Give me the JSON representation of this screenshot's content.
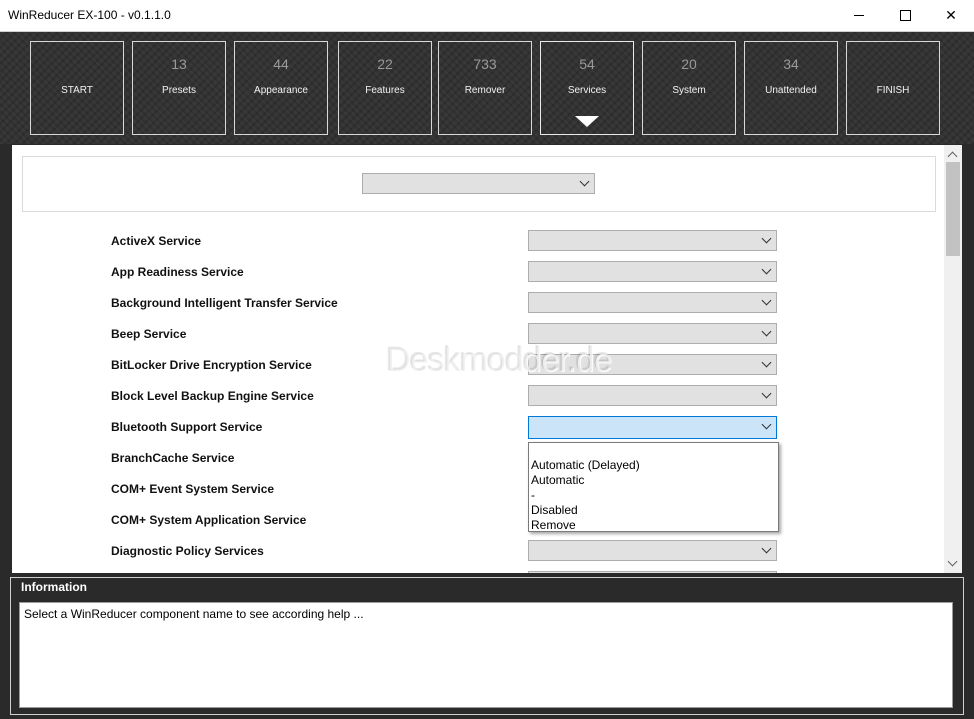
{
  "window": {
    "title": "WinReducer EX-100 - v0.1.1.0"
  },
  "steps": [
    {
      "count": "",
      "label": "START"
    },
    {
      "count": "13",
      "label": "Presets"
    },
    {
      "count": "44",
      "label": "Appearance"
    },
    {
      "count": "22",
      "label": "Features"
    },
    {
      "count": "733",
      "label": "Remover"
    },
    {
      "count": "54",
      "label": "Services"
    },
    {
      "count": "20",
      "label": "System"
    },
    {
      "count": "34",
      "label": "Unattended"
    },
    {
      "count": "",
      "label": "FINISH"
    }
  ],
  "active_step": "Services",
  "preset_select": {
    "value": ""
  },
  "services": [
    {
      "label": "ActiveX Service",
      "value": ""
    },
    {
      "label": "App Readiness Service",
      "value": ""
    },
    {
      "label": "Background Intelligent Transfer Service",
      "value": ""
    },
    {
      "label": "Beep Service",
      "value": ""
    },
    {
      "label": "BitLocker Drive Encryption Service",
      "value": ""
    },
    {
      "label": "Block Level Backup Engine Service",
      "value": ""
    },
    {
      "label": "Bluetooth Support Service",
      "value": ""
    },
    {
      "label": "BranchCache Service",
      "value": ""
    },
    {
      "label": "COM+ Event System Service",
      "value": ""
    },
    {
      "label": "COM+ System Application Service",
      "value": ""
    },
    {
      "label": "Diagnostic Policy Services",
      "value": ""
    }
  ],
  "open_dropdown": {
    "for": "Bluetooth Support Service",
    "options": [
      "",
      "Automatic (Delayed)",
      "Automatic",
      "-",
      "Disabled",
      "Remove"
    ]
  },
  "watermark": "Deskmodder.de",
  "info": {
    "title": "Information",
    "text": "Select a WinReducer component name to see according help ..."
  },
  "colors": {
    "header_bg": "#333333",
    "focus_blue": "#cce4f7",
    "focus_border": "#0078d7"
  }
}
